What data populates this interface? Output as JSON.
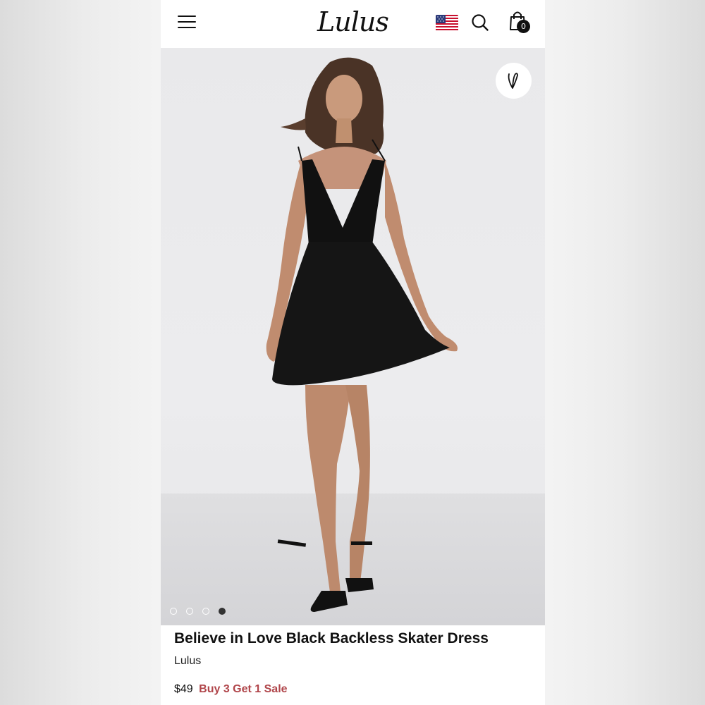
{
  "header": {
    "logo_text": "Lulus",
    "cart_count": "0",
    "icons": [
      "menu-icon",
      "us-flag-icon",
      "search-icon",
      "shopping-bag-icon"
    ]
  },
  "gallery": {
    "image_count": 4,
    "active_index": 3,
    "wishlist_icon": "heart-icon"
  },
  "product": {
    "title": "Believe in Love Black Backless Skater Dress",
    "brand": "Lulus",
    "price": "$49",
    "promo": "Buy 3 Get 1 Sale"
  },
  "colors": {
    "promo": "#b0454a",
    "text": "#111111"
  }
}
